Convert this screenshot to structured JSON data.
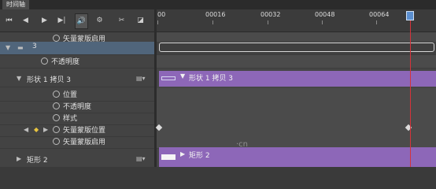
{
  "panel": {
    "tab_title": "时间轴"
  },
  "toolbar": {
    "buttons": [
      {
        "name": "first-frame-button",
        "glyph": "⏮"
      },
      {
        "name": "prev-frame-button",
        "glyph": "◀"
      },
      {
        "name": "play-button",
        "glyph": "▶"
      },
      {
        "name": "next-frame-button",
        "glyph": "▶|"
      },
      {
        "name": "audio-button",
        "glyph": "🔊"
      },
      {
        "name": "settings-button",
        "glyph": "⚙"
      },
      {
        "name": "split-button",
        "glyph": "✂"
      },
      {
        "name": "transition-button",
        "glyph": "◪"
      }
    ]
  },
  "ruler": {
    "labels": [
      "00",
      "00016",
      "00032",
      "00048",
      "00064"
    ]
  },
  "layers": [
    {
      "label": "矢量蒙版启用",
      "type": "property"
    },
    {
      "label": "3",
      "type": "group"
    },
    {
      "label": "不透明度",
      "type": "property"
    },
    {
      "label": "形状 1 拷贝 3",
      "type": "layer"
    },
    {
      "label": "位置",
      "type": "property"
    },
    {
      "label": "不透明度",
      "type": "property"
    },
    {
      "label": "样式",
      "type": "property"
    },
    {
      "label": "矢量蒙版位置",
      "type": "property"
    },
    {
      "label": "矢量蒙版启用",
      "type": "property"
    },
    {
      "label": "矩形 2",
      "type": "layer"
    }
  ],
  "clips": [
    {
      "label": "形状 1 拷贝 3"
    },
    {
      "label": "矩形 2"
    }
  ],
  "watermark": "·cn",
  "colors": {
    "clip_purple": "#8d67b8",
    "playhead": "#d6333b",
    "group_row": "#50657b"
  }
}
